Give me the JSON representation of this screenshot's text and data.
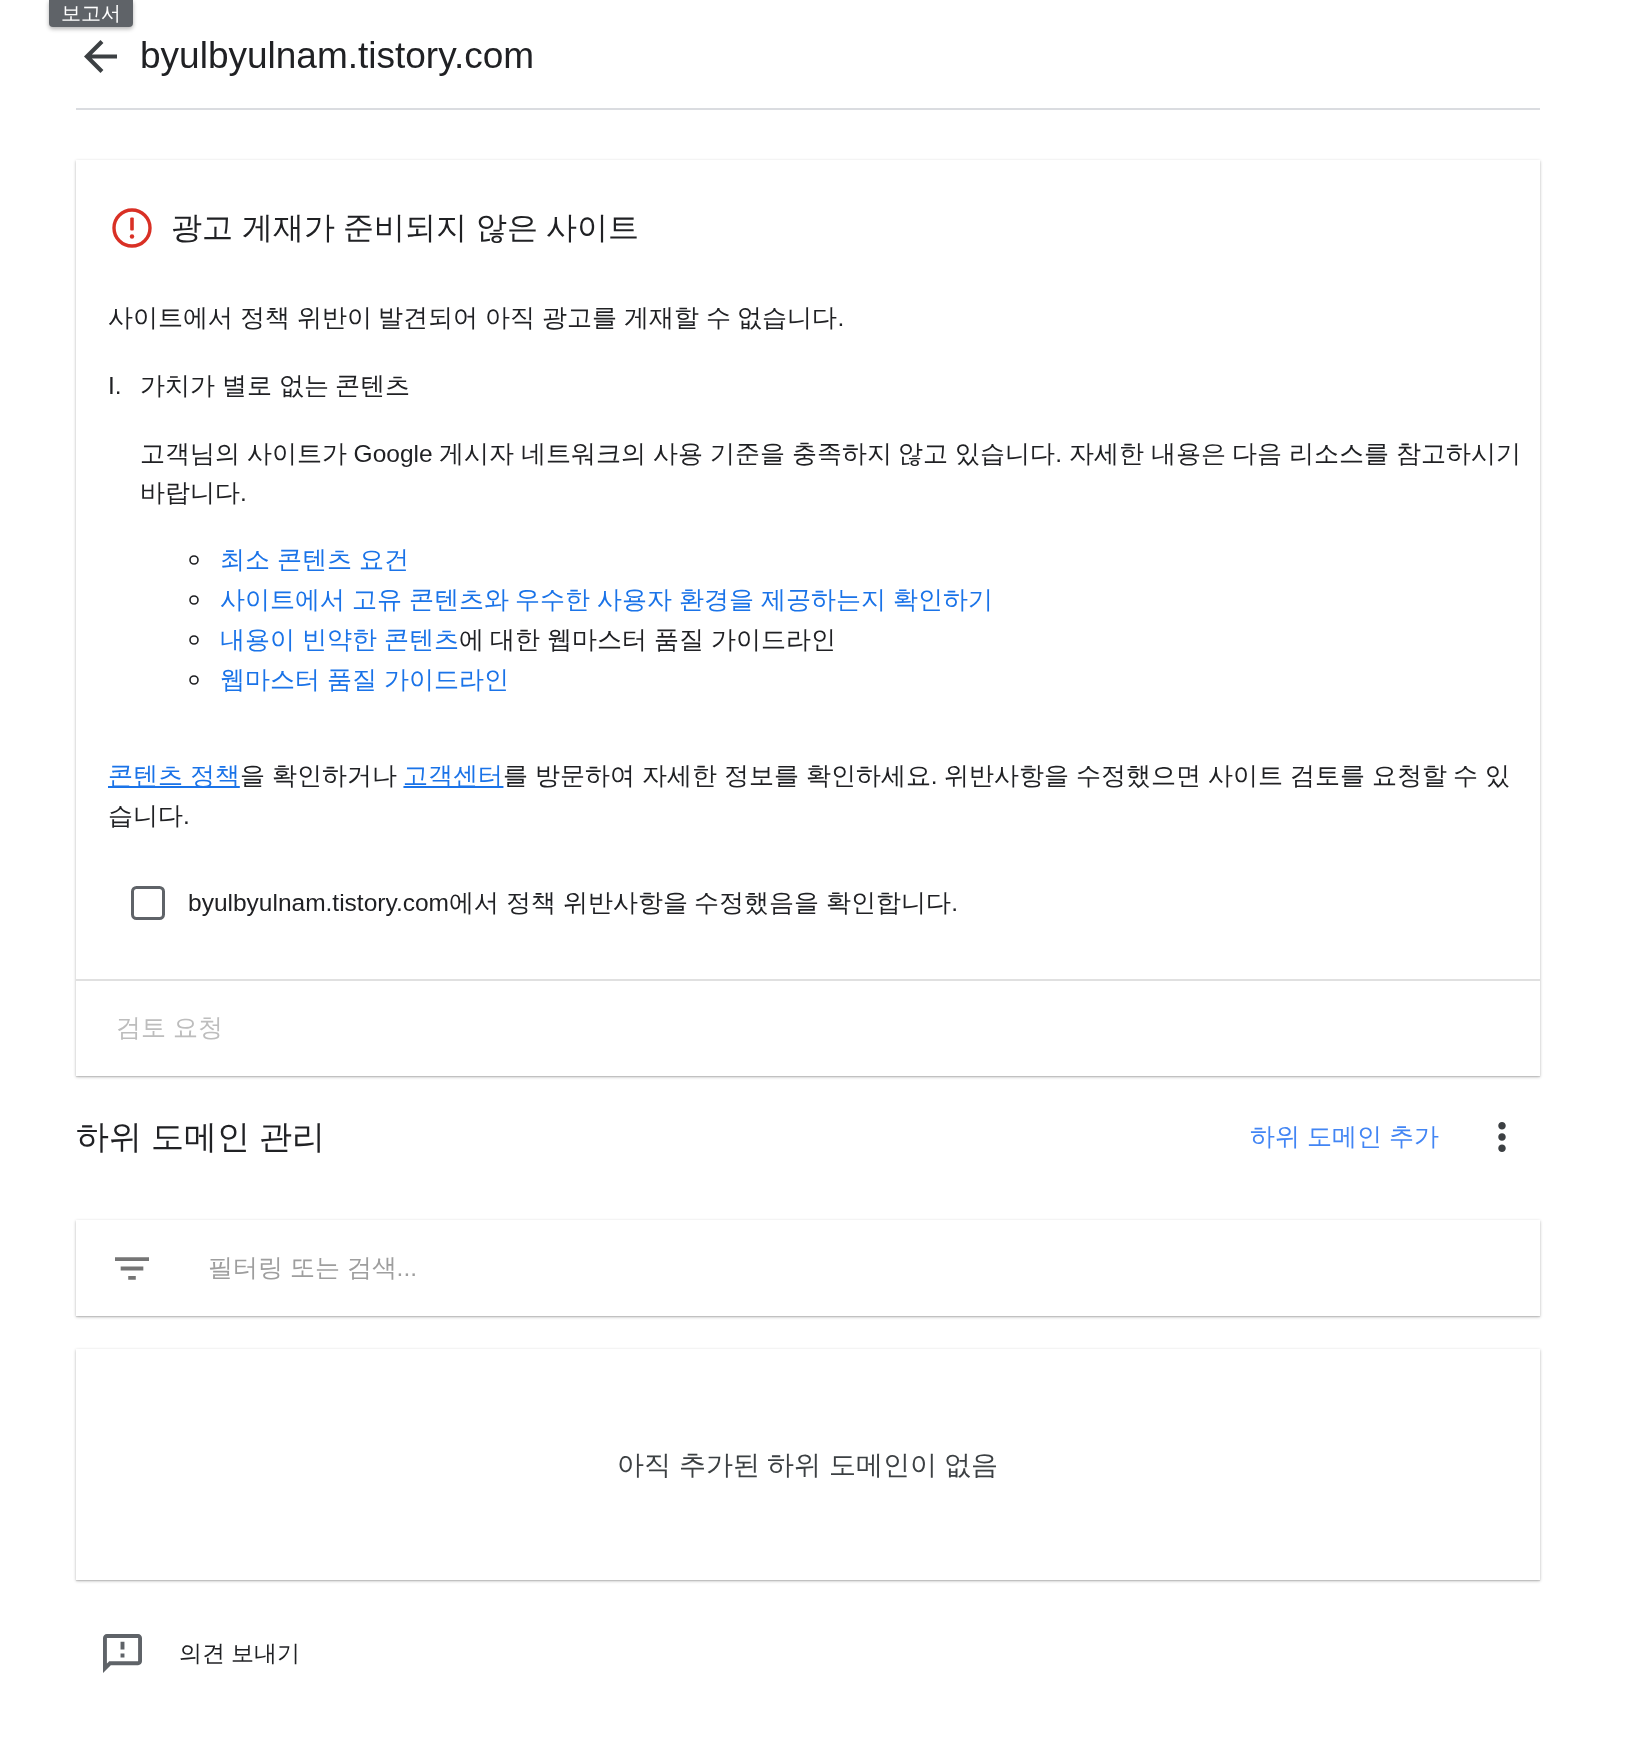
{
  "tooltip": {
    "text": "보고서"
  },
  "header": {
    "title": "byulbyulnam.tistory.com"
  },
  "status_card": {
    "title": "광고 게재가 준비되지 않은 사이트",
    "summary": "사이트에서 정책 위반이 발견되어 아직 광고를 게재할 수 없습니다.",
    "issues": [
      {
        "number": "I.",
        "title": "가치가 별로 없는 콘텐츠",
        "description": "고객님의 사이트가 Google 게시자 네트워크의 사용 기준을 충족하지 않고 있습니다. 자세한 내용은 다음 리소스를 참고하시기 바랍니다.",
        "resources": [
          {
            "parts": [
              {
                "kind": "link",
                "text": "최소 콘텐츠 요건"
              }
            ]
          },
          {
            "parts": [
              {
                "kind": "link",
                "text": "사이트에서 고유 콘텐츠와 우수한 사용자 환경을 제공하는지 확인하기"
              }
            ]
          },
          {
            "parts": [
              {
                "kind": "link",
                "text": "내용이 빈약한 콘텐츠"
              },
              {
                "kind": "text",
                "text": "에 대한 웹마스터 품질 가이드라인"
              }
            ]
          },
          {
            "parts": [
              {
                "kind": "link",
                "text": "웹마스터 품질 가이드라인"
              }
            ]
          }
        ]
      }
    ],
    "help_text": [
      {
        "kind": "link",
        "text": "콘텐츠 정책"
      },
      {
        "kind": "text",
        "text": "을 확인하거나 "
      },
      {
        "kind": "link",
        "text": "고객센터"
      },
      {
        "kind": "text",
        "text": "를 방문하여 자세한 정보를 확인하세요. 위반사항을 수정했으면 사이트 검토를 요청할 수 있습니다."
      }
    ],
    "confirmation": {
      "label": "byulbyulnam.tistory.com에서 정책 위반사항을 수정했음을 확인합니다.",
      "checked": false
    },
    "request_review_button": {
      "label": "검토 요청",
      "disabled": true
    }
  },
  "subdomains": {
    "title": "하위 도메인 관리",
    "add_button": {
      "label": "하위 도메인 추가"
    },
    "search": {
      "placeholder": "필터링 또는 검색..."
    },
    "empty_message": "아직 추가된 하위 도메인이 없음"
  },
  "feedback": {
    "label": "의견 보내기"
  }
}
